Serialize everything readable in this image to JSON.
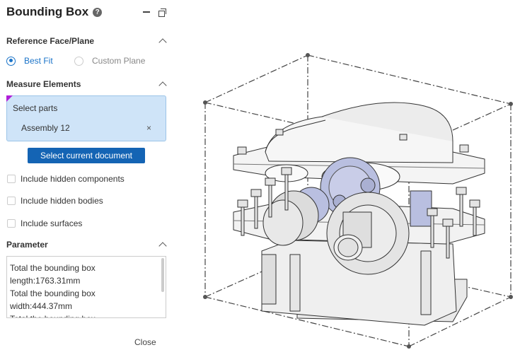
{
  "panel": {
    "title": "Bounding Box",
    "help_icon": "?",
    "reference": {
      "title": "Reference Face/Plane",
      "options": [
        {
          "label": "Best Fit",
          "selected": true
        },
        {
          "label": "Custom Plane",
          "selected": false
        }
      ]
    },
    "measure": {
      "title": "Measure Elements",
      "select_label": "Select parts",
      "selected_item": "Assembly 12",
      "remove_icon": "×",
      "button_label": "Select current document"
    },
    "options": [
      {
        "label": "Include hidden components",
        "checked": false
      },
      {
        "label": "Include hidden bodies",
        "checked": false
      },
      {
        "label": "Include surfaces",
        "checked": false
      }
    ],
    "parameter": {
      "title": "Parameter",
      "lines": [
        "Total the bounding box",
        "length:1763.31mm",
        "Total the bounding box",
        "width:444.37mm",
        "Total the bounding box"
      ]
    },
    "close_label": "Close"
  },
  "colors": {
    "accent": "#1a73c8",
    "button": "#1464b4",
    "selection_bg": "#cfe4f8",
    "marker": "#b01ed8",
    "gear": "#b9bfe0"
  },
  "icons": [
    "help-icon",
    "minimize-icon",
    "restore-icon",
    "chevron-up-icon",
    "close-icon"
  ]
}
